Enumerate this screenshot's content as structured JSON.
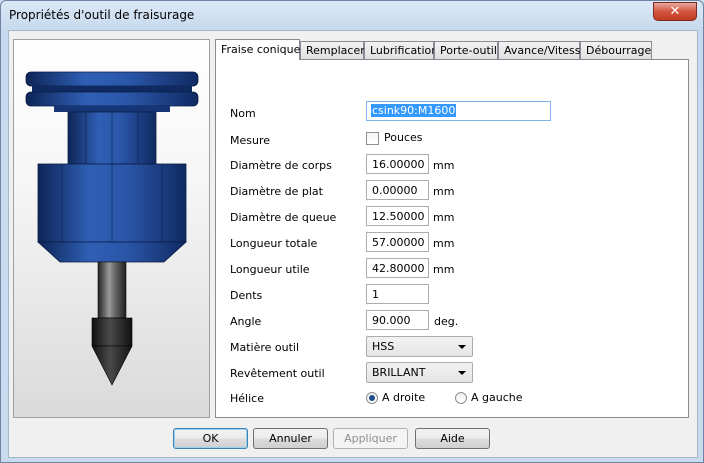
{
  "window": {
    "title": "Propriétés d'outil de fraisurage",
    "close_glyph": "✕"
  },
  "tabs": [
    "Fraise conique",
    "Remplacer",
    "Lubrification",
    "Porte-outil",
    "Avance/Vitesse",
    "Débourrage"
  ],
  "active_tab": "Fraise conique",
  "form": {
    "name": {
      "label": "Nom",
      "value": "csink90:M1600"
    },
    "measure": {
      "label": "Mesure",
      "checkbox_label": "Pouces",
      "checked": false
    },
    "body_diameter": {
      "label": "Diamètre de corps",
      "value": "16.00000",
      "unit": "mm"
    },
    "flat_diameter": {
      "label": "Diamètre de plat",
      "value": "0.00000",
      "unit": "mm"
    },
    "shank_diameter": {
      "label": "Diamètre de queue",
      "value": "12.50000",
      "unit": "mm"
    },
    "total_length": {
      "label": "Longueur totale",
      "value": "57.00000",
      "unit": "mm"
    },
    "useful_length": {
      "label": "Longueur utile",
      "value": "42.80000",
      "unit": "mm"
    },
    "teeth": {
      "label": "Dents",
      "value": "1"
    },
    "angle": {
      "label": "Angle",
      "value": "90.000",
      "unit": "deg."
    },
    "tool_material": {
      "label": "Matière outil",
      "value": "HSS"
    },
    "tool_coating": {
      "label": "Revêtement outil",
      "value": "BRILLANT"
    },
    "helix": {
      "label": "Hélice",
      "options": [
        "A droite",
        "A gauche"
      ],
      "selected": "A droite"
    }
  },
  "buttons": {
    "ok": "OK",
    "cancel": "Annuler",
    "apply": "Appliquer",
    "help": "Aide"
  },
  "colors": {
    "holder_blue": "#2a56a8",
    "holder_dark": "#16306a",
    "cutter_dark": "#2a2a2a"
  },
  "icons": {
    "close": "close-icon",
    "tool_preview": "countersink-tool-image"
  }
}
